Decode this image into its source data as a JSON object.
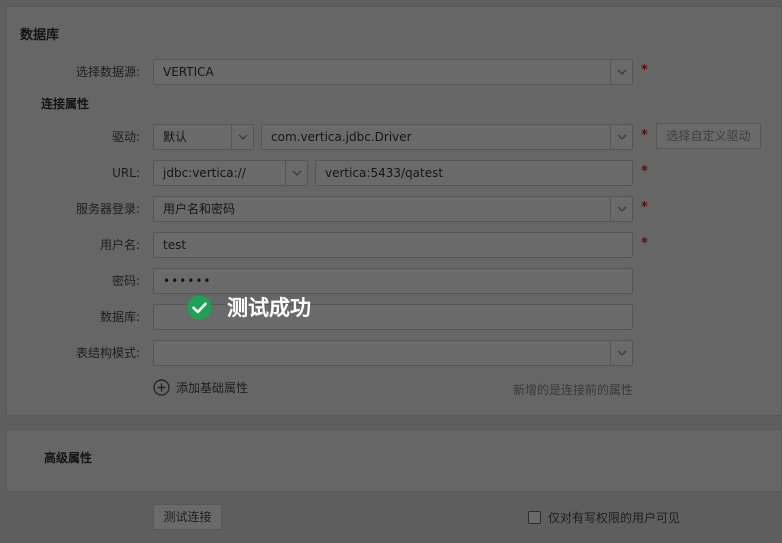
{
  "db_section": {
    "title": "数据库",
    "datasource_label": "选择数据源:",
    "datasource_value": "VERTICA",
    "conn_props_title": "连接属性",
    "driver_label": "驱动:",
    "driver_type": "默认",
    "driver_class": "com.vertica.jdbc.Driver",
    "custom_driver_button": "选择自定义驱动",
    "url_label": "URL:",
    "url_prefix": "jdbc:vertica://",
    "url_value": "vertica:5433/qatest",
    "login_label": "服务器登录:",
    "login_value": "用户名和密码",
    "username_label": "用户名:",
    "username_value": "test",
    "password_label": "密码:",
    "password_value": "••••••",
    "database_label": "数据库:",
    "database_value": "",
    "schema_label": "表结构模式:",
    "schema_value": "",
    "add_basic_prop": "添加基础属性",
    "hint": "新增的是连接前的属性",
    "required_mark": "*"
  },
  "advanced_section": {
    "title": "高级属性"
  },
  "footer": {
    "test_button": "测试连接",
    "checkbox_label": "仅对有写权限的用户可见"
  },
  "toast": {
    "message": "测试成功"
  },
  "colors": {
    "success": "#1fa153",
    "overlay_text": "#ffffff"
  }
}
